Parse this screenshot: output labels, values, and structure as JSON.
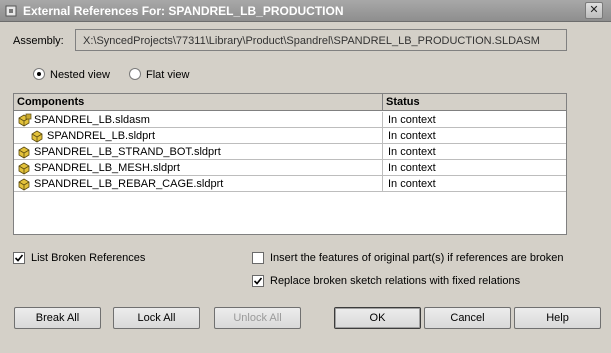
{
  "window": {
    "title": "External References For: SPANDREL_LB_PRODUCTION",
    "close_glyph": "✕"
  },
  "assembly": {
    "label": "Assembly:",
    "path": "X:\\SyncedProjects\\77311\\Library\\Product\\Spandrel\\SPANDREL_LB_PRODUCTION.SLDASM"
  },
  "view_options": {
    "nested": "Nested view",
    "flat": "Flat view",
    "selected": "nested"
  },
  "table": {
    "headers": [
      "Components",
      "Status"
    ],
    "rows": [
      {
        "name": "SPANDREL_LB.sldasm",
        "status": "In context",
        "icon": "assembly-icon",
        "indent": 0
      },
      {
        "name": "SPANDREL_LB.sldprt",
        "status": "In context",
        "icon": "part-icon",
        "indent": 1
      },
      {
        "name": "SPANDREL_LB_STRAND_BOT.sldprt",
        "status": "In context",
        "icon": "part-icon",
        "indent": 0
      },
      {
        "name": "SPANDREL_LB_MESH.sldprt",
        "status": "In context",
        "icon": "part-icon",
        "indent": 0
      },
      {
        "name": "SPANDREL_LB_REBAR_CAGE.sldprt",
        "status": "In context",
        "icon": "part-icon",
        "indent": 0
      }
    ]
  },
  "options": {
    "list_broken": {
      "label": "List Broken References",
      "checked": true
    },
    "insert_features": {
      "label": "Insert the features of original part(s) if references are broken",
      "checked": false
    },
    "replace_relations": {
      "label": "Replace broken sketch relations with fixed relations",
      "checked": true
    }
  },
  "buttons": {
    "break_all": "Break All",
    "lock_all": "Lock All",
    "unlock_all": "Unlock All",
    "ok": "OK",
    "cancel": "Cancel",
    "help": "Help"
  }
}
